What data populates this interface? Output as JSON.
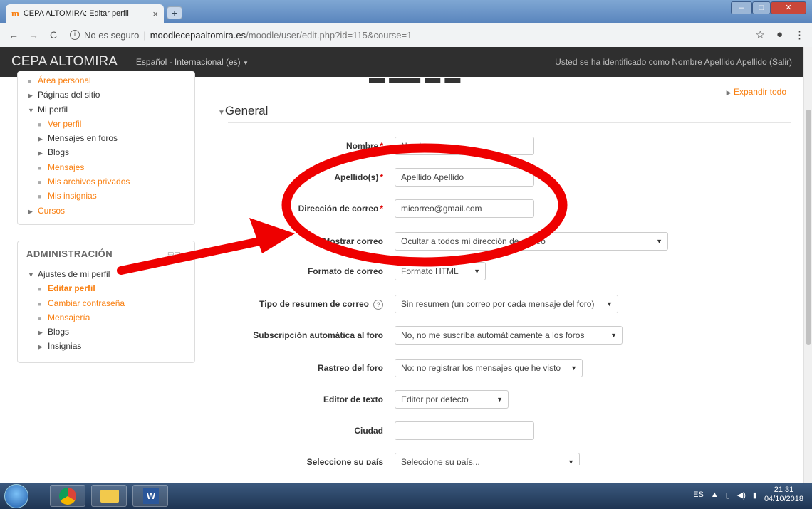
{
  "browser": {
    "tab_title": "CEPA ALTOMIRA: Editar perfil",
    "tab_close": "×",
    "new_tab": "+",
    "url_security": "No es seguro",
    "url_host": "moodlecepaaltomira.es",
    "url_path": "/moodle/user/edit.php?id=115&course=1"
  },
  "navbar": {
    "brand": "CEPA ALTOMIRA",
    "language": "Español - Internacional (es)",
    "login_info": "Usted se ha identificado como Nombre Apellido Apellido (Salir)"
  },
  "navigation": {
    "items": [
      {
        "label": "Área personal"
      },
      {
        "label": "Páginas del sitio"
      },
      {
        "label": "Mi perfil"
      },
      {
        "label": "Ver perfil"
      },
      {
        "label": "Mensajes en foros"
      },
      {
        "label": "Blogs"
      },
      {
        "label": "Mensajes"
      },
      {
        "label": "Mis archivos privados"
      },
      {
        "label": "Mis insignias"
      },
      {
        "label": "Cursos"
      }
    ]
  },
  "administration": {
    "title": "ADMINISTRACIÓN",
    "items": [
      {
        "label": "Ajustes de mi perfil"
      },
      {
        "label": "Editar perfil"
      },
      {
        "label": "Cambiar contraseña"
      },
      {
        "label": "Mensajería"
      },
      {
        "label": "Blogs"
      },
      {
        "label": "Insignias"
      }
    ]
  },
  "form": {
    "expand_all": "Expandir todo",
    "section_title": "General",
    "nombre": {
      "label": "Nombre",
      "value": "Nombre"
    },
    "apellidos": {
      "label": "Apellido(s)",
      "value": "Apellido Apellido"
    },
    "correo": {
      "label": "Dirección de correo",
      "value": "micorreo@gmail.com"
    },
    "mostrar_correo": {
      "label": "Mostrar correo",
      "value": "Ocultar a todos mi dirección de correo"
    },
    "formato_correo": {
      "label": "Formato de correo",
      "value": "Formato HTML"
    },
    "resumen_correo": {
      "label": "Tipo de resumen de correo",
      "value": "Sin resumen (un correo por cada mensaje del foro)"
    },
    "subscripcion": {
      "label": "Subscripción automática al foro",
      "value": "No, no me suscriba automáticamente a los foros"
    },
    "rastreo": {
      "label": "Rastreo del foro",
      "value": "No: no registrar los mensajes que he visto"
    },
    "editor": {
      "label": "Editor de texto",
      "value": "Editor por defecto"
    },
    "ciudad": {
      "label": "Ciudad",
      "value": ""
    },
    "pais": {
      "label": "Seleccione su país",
      "value": "Seleccione su país..."
    }
  },
  "taskbar": {
    "language": "ES",
    "time": "21:31",
    "date": "04/10/2018"
  },
  "colors": {
    "moodle_orange": "#f98012",
    "navbar": "#2f2f2f",
    "annotation_red": "#ee0000"
  }
}
